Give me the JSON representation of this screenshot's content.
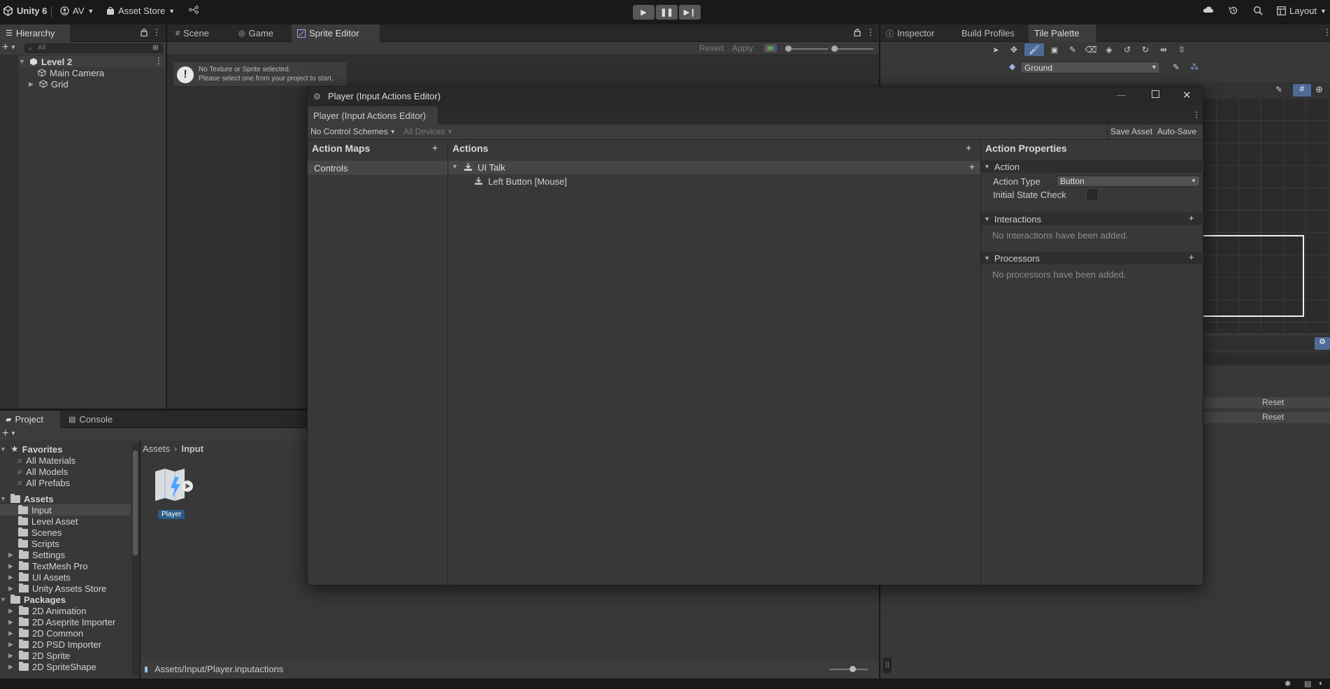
{
  "topbar": {
    "app_name": "Unity 6",
    "account": "AV",
    "asset_store": "Asset Store",
    "layout": "Layout"
  },
  "hierarchy": {
    "tab": "Hierarchy",
    "search_placeholder": "All",
    "scene": "Level 2",
    "items": [
      "Main Camera",
      "Grid"
    ]
  },
  "center_tabs": [
    "Scene",
    "Game",
    "Sprite Editor"
  ],
  "sprite_editor": {
    "revert": "Revert",
    "apply": "Apply",
    "notice_line1": "No Texture or Sprite selected.",
    "notice_line2": "Please select one from your project to start."
  },
  "right_tabs": [
    "Inspector",
    "Build Profiles",
    "Tile Palette"
  ],
  "tile_palette": {
    "palette": "Ground",
    "reset_labels": [
      "Reset",
      "Reset"
    ]
  },
  "project": {
    "tabs": [
      "Project",
      "Console"
    ],
    "favorites_label": "Favorites",
    "favorites": [
      "All Materials",
      "All Models",
      "All Prefabs"
    ],
    "assets_label": "Assets",
    "assets": [
      "Input",
      "Level Asset",
      "Scenes",
      "Scripts",
      "Settings",
      "TextMesh Pro",
      "UI Assets",
      "Unity Assets Store"
    ],
    "packages_label": "Packages",
    "packages": [
      "2D Animation",
      "2D Aseprite Importer",
      "2D Common",
      "2D PSD Importer",
      "2D Sprite",
      "2D SpriteShape"
    ],
    "breadcrumb": [
      "Assets",
      "Input"
    ],
    "asset_item": "Player",
    "footer_path": "Assets/Input/Player.inputactions"
  },
  "editor": {
    "window_title": "Player (Input Actions Editor)",
    "tab_title": "Player (Input Actions Editor)",
    "control_schemes": "No Control Schemes",
    "devices": "All Devices",
    "save_asset": "Save Asset",
    "auto_save": "Auto-Save",
    "action_maps_header": "Action Maps",
    "action_maps": [
      "Controls"
    ],
    "actions_header": "Actions",
    "action_name": "UI Talk",
    "binding_name": "Left Button [Mouse]",
    "properties_header": "Action Properties",
    "action_section": "Action",
    "action_type_label": "Action Type",
    "action_type_value": "Button",
    "initial_state_label": "Initial State Check",
    "interactions_label": "Interactions",
    "interactions_empty": "No interactions have been added.",
    "processors_label": "Processors",
    "processors_empty": "No processors have been added."
  }
}
